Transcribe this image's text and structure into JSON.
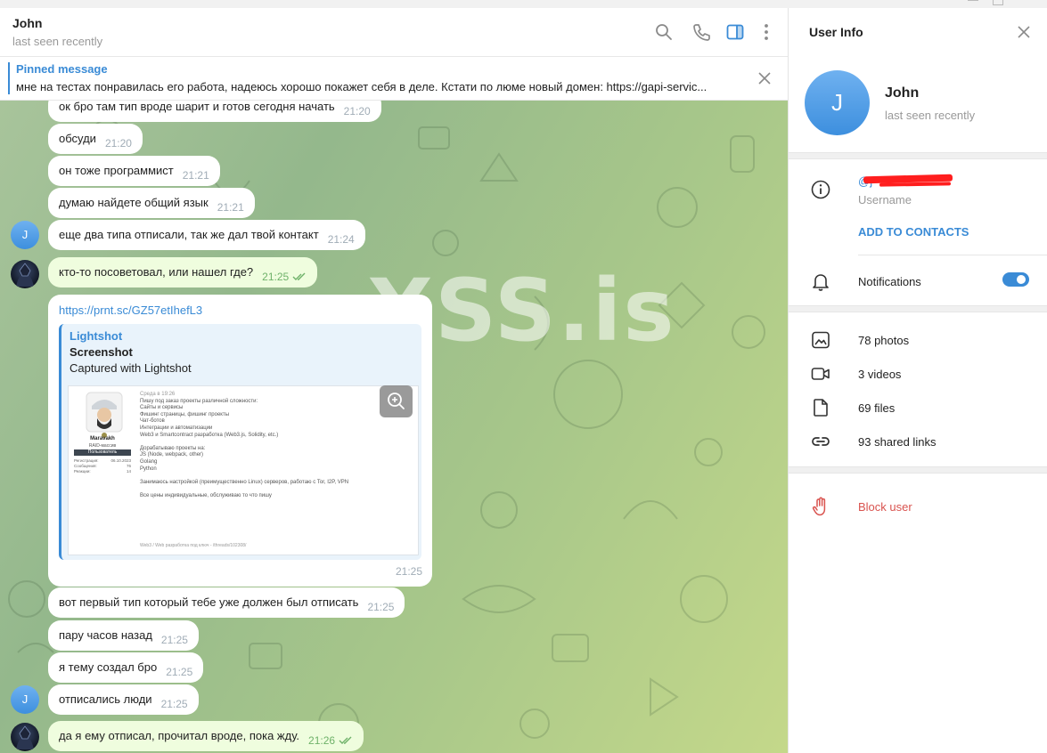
{
  "chat": {
    "title": "John",
    "status": "last seen recently",
    "pinned": {
      "title": "Pinned message",
      "text": "мне на тестах понравилась его работа, надеюсь хорошо покажет себя в деле.  Кстати по люме новый домен: https://gapi-servic..."
    },
    "watermark": "XSS.is",
    "messages": [
      {
        "text": "ок бро там тип вроде шарит и готов сегодня начать",
        "time": "21:20"
      },
      {
        "text": "обсуди",
        "time": "21:20"
      },
      {
        "text": "он тоже программист",
        "time": "21:21"
      },
      {
        "text": "думаю найдете общий язык",
        "time": "21:21"
      },
      {
        "text": "еще два типа отписали, так же дал твой контакт",
        "time": "21:24"
      },
      {
        "text": "кто-то посоветовал, или нашел где?",
        "time": "21:25"
      },
      {
        "text": "вот первый тип который тебе уже должен был отписать",
        "time": "21:25"
      },
      {
        "text": "пару часов назад",
        "time": "21:25"
      },
      {
        "text": "я тему создал бро",
        "time": "21:25"
      },
      {
        "text": "отписались люди",
        "time": "21:25"
      },
      {
        "text": "да я ему отписал, прочитал вроде, пока жду.",
        "time": "21:26"
      }
    ],
    "avatar_letter": "J",
    "link_message": {
      "url": "https://prnt.sc/GZ57etIhefL3",
      "site": "Lightshot",
      "title": "Screenshot",
      "description": "Captured with Lightshot",
      "time": "21:25",
      "screenshot": {
        "date": "Среда в 19:26",
        "user": "Maravakh",
        "role": "RAID-массив",
        "badge": "Пользователь",
        "stats": [
          {
            "k": "Регистрация:",
            "v": "06.10.2023"
          },
          {
            "k": "Сообщения:",
            "v": "76"
          },
          {
            "k": "Реакции:",
            "v": "14"
          }
        ],
        "lines": [
          "Пишу под заказ проекты различной сложности:",
          "Сайты и сервисы",
          "Фишинг страницы, фишинг проекты",
          "Чат-ботов",
          "Интеграции и автоматизации",
          "Web3 и Smartcontract разработка (Web3.js, Solidity, etc.)",
          "",
          "Дорабатываю проекты на:",
          "JS (Node, webpack, other)",
          "Golang",
          "Python",
          "",
          "Занимаюсь настройкой (преимущественно Linux) серверов, работаю с Tor, I2P, VPN",
          "",
          "Все цены индивидуальные, обслуживаю то что пишу"
        ],
        "footer": "Web3 / Web разработка под ключ - /threads/102308/"
      }
    }
  },
  "info": {
    "title": "User Info",
    "name": "John",
    "status": "last seen recently",
    "avatar_letter": "J",
    "username_value": "@j",
    "username_label": "Username",
    "add_contacts": "ADD TO CONTACTS",
    "notifications": "Notifications",
    "notifications_on": true,
    "media": {
      "photos": "78 photos",
      "videos": "3 videos",
      "files": "69 files",
      "links": "93 shared links"
    },
    "block": "Block user"
  },
  "colors": {
    "accent": "#3a8bd6",
    "outgoing_bubble": "#effdde",
    "danger": "#d9534f",
    "redaction": "#ff1e1e"
  }
}
